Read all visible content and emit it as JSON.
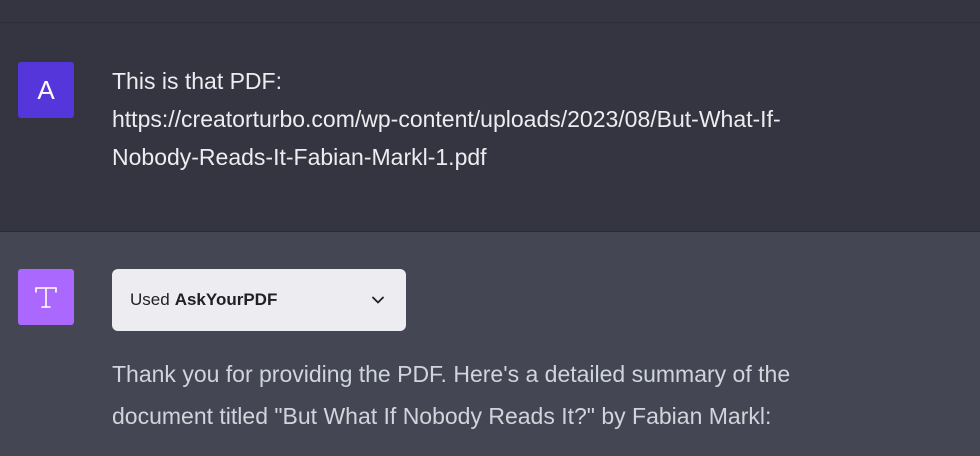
{
  "user_message": {
    "avatar_letter": "A",
    "avatar_color": "#5436da",
    "lines": [
      "This is that PDF:",
      "https://creatorturbo.com/wp-content/uploads/2023/08/But-What-If-",
      "Nobody-Reads-It-Fabian-Markl-1.pdf"
    ]
  },
  "assistant_message": {
    "avatar_color": "#ab68ff",
    "avatar_icon": "typewriter-t-icon",
    "plugin": {
      "prefix": "Used",
      "name": "AskYourPDF",
      "icon": "chevron-down-icon"
    },
    "lines": [
      "Thank you for providing the PDF. Here's a detailed summary of the",
      "document titled \"But What If Nobody Reads It?\" by Fabian Markl:"
    ]
  }
}
